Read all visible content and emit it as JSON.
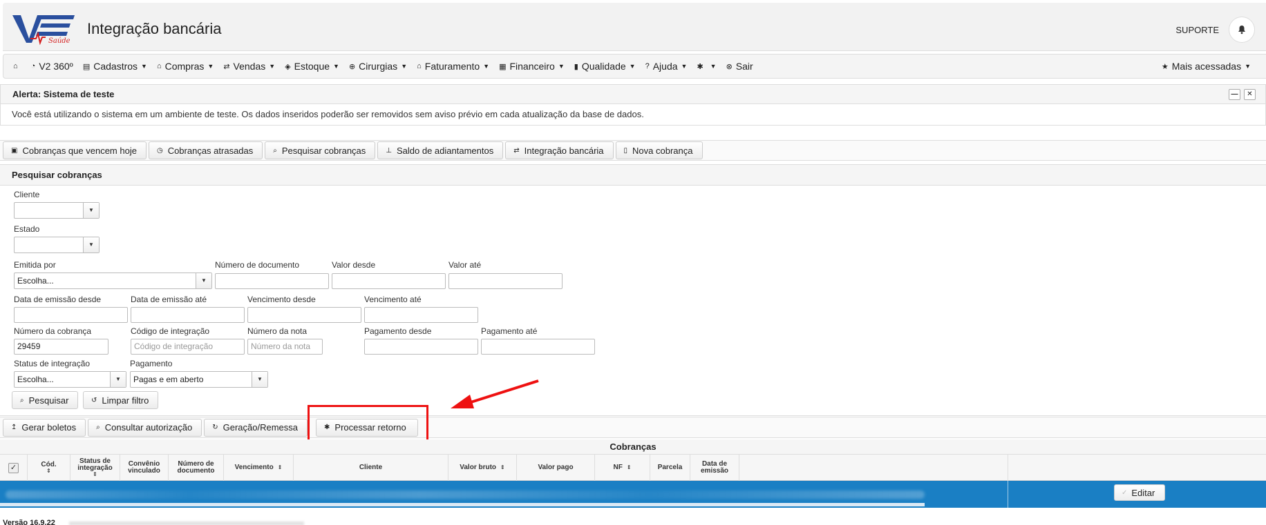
{
  "header": {
    "app_title": "Integração bancária",
    "logo_text": "V2 Saúde",
    "user_label": "SUPORTE",
    "bell_icon": "bell-icon"
  },
  "menu": {
    "items": [
      {
        "icon": "home-icon",
        "label": ""
      },
      {
        "icon": "chart-icon",
        "label": "V2 360º"
      },
      {
        "icon": "archive-icon",
        "label": "Cadastros",
        "caret": true
      },
      {
        "icon": "bank-icon",
        "label": "Compras",
        "caret": true
      },
      {
        "icon": "exchange-icon",
        "label": "Vendas",
        "caret": true
      },
      {
        "icon": "tag-icon",
        "label": "Estoque",
        "caret": true
      },
      {
        "icon": "plus-circle-icon",
        "label": "Cirurgias",
        "caret": true
      },
      {
        "icon": "bank-icon",
        "label": "Faturamento",
        "caret": true
      },
      {
        "icon": "calculator-icon",
        "label": "Financeiro",
        "caret": true
      },
      {
        "icon": "book-icon",
        "label": "Qualidade",
        "caret": true
      },
      {
        "icon": "question-icon",
        "label": "Ajuda",
        "caret": true
      },
      {
        "icon": "gear-icon",
        "label": "",
        "caret": true
      },
      {
        "icon": "close-circle-icon",
        "label": "Sair"
      }
    ],
    "right_label": "Mais acessadas"
  },
  "alert": {
    "title": "Alerta: Sistema de teste",
    "message": "Você está utilizando o sistema em um ambiente de teste. Os dados inseridos poderão ser removidos sem aviso prévio em cada atualização da base de dados."
  },
  "tabs": [
    {
      "icon": "calendar-icon",
      "label": "Cobranças que vencem hoje"
    },
    {
      "icon": "clock-icon",
      "label": "Cobranças atrasadas"
    },
    {
      "icon": "search-icon",
      "label": "Pesquisar cobranças"
    },
    {
      "icon": "pin-icon",
      "label": "Saldo de adiantamentos"
    },
    {
      "icon": "exchange-icon",
      "label": "Integração bancária"
    },
    {
      "icon": "document-icon",
      "label": "Nova cobrança"
    }
  ],
  "search": {
    "title": "Pesquisar cobranças",
    "cliente": {
      "label": "Cliente",
      "value": ""
    },
    "estado": {
      "label": "Estado",
      "value": ""
    },
    "emitida_por": {
      "label": "Emitida por",
      "value": "Escolha..."
    },
    "numero_documento": {
      "label": "Número de documento",
      "value": ""
    },
    "valor_desde": {
      "label": "Valor desde",
      "value": ""
    },
    "valor_ate": {
      "label": "Valor até",
      "value": ""
    },
    "data_emissao_desde": {
      "label": "Data de emissão desde",
      "value": ""
    },
    "data_emissao_ate": {
      "label": "Data de emissão até",
      "value": ""
    },
    "vencimento_desde": {
      "label": "Vencimento desde",
      "value": ""
    },
    "vencimento_ate": {
      "label": "Vencimento até",
      "value": ""
    },
    "numero_cobranca": {
      "label": "Número da cobrança",
      "value": "29459"
    },
    "codigo_integracao": {
      "label": "Código de integração",
      "placeholder": "Código de integração"
    },
    "numero_nota": {
      "label": "Número da nota",
      "placeholder": "Número da nota"
    },
    "pagamento_desde": {
      "label": "Pagamento desde",
      "value": ""
    },
    "pagamento_ate": {
      "label": "Pagamento até",
      "value": ""
    },
    "status_integracao": {
      "label": "Status de integração",
      "value": "Escolha..."
    },
    "pagamento": {
      "label": "Pagamento",
      "value": "Pagas e em aberto"
    },
    "search_button": "Pesquisar",
    "clear_button": "Limpar filtro"
  },
  "actions": [
    {
      "icon": "upload-icon",
      "label": "Gerar boletos"
    },
    {
      "icon": "search-icon",
      "label": "Consultar autorização"
    },
    {
      "icon": "refresh-icon",
      "label": "Geração/Remessa"
    },
    {
      "icon": "gear-icon",
      "label": "Processar retorno"
    }
  ],
  "table": {
    "caption": "Cobranças",
    "columns": [
      "Cód.",
      "Status de integração",
      "Convênio vinculado",
      "Número de documento",
      "Vencimento",
      "Cliente",
      "Valor bruto",
      "Valor pago",
      "NF",
      "Parcela",
      "Data de emissão"
    ],
    "row_action": "Editar"
  },
  "footer": {
    "version": "Versão 16.9.22"
  },
  "colors": {
    "selected_row": "#1a7fc4",
    "highlight_box": "#ee1111"
  }
}
